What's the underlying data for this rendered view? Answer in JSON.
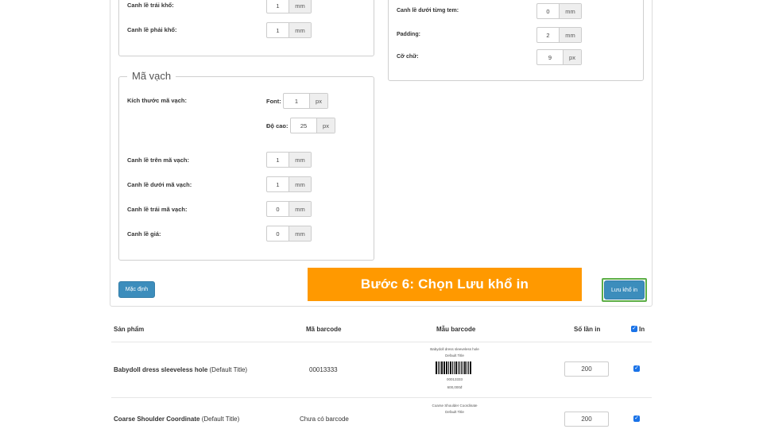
{
  "page_setup": {
    "left_margin": {
      "label": "Canh lề trái khổ:",
      "value": "1",
      "unit": "mm"
    },
    "right_margin": {
      "label": "Canh lề phải khổ:",
      "value": "1",
      "unit": "mm"
    }
  },
  "label_setup": {
    "bottom_margin": {
      "label": "Canh lề dưới từng tem:",
      "value": "0",
      "unit": "mm"
    },
    "padding": {
      "label": "Padding:",
      "value": "2",
      "unit": "mm"
    },
    "font_size": {
      "label": "Cỡ chữ:",
      "value": "9",
      "unit": "px"
    }
  },
  "barcode_section": {
    "legend": "Mã vạch",
    "size_label": "Kích thước mã vạch:",
    "font": {
      "label": "Font:",
      "value": "1",
      "unit": "px"
    },
    "height": {
      "label": "Độ cao:",
      "value": "25",
      "unit": "px"
    },
    "top_margin": {
      "label": "Canh lề trên mã vạch:",
      "value": "1",
      "unit": "mm"
    },
    "bottom_margin": {
      "label": "Canh lề dưới mã vạch:",
      "value": "1",
      "unit": "mm"
    },
    "left_margin": {
      "label": "Canh lề trái mã vạch:",
      "value": "0",
      "unit": "mm"
    },
    "price_margin": {
      "label": "Canh lề giá:",
      "value": "0",
      "unit": "mm"
    }
  },
  "buttons": {
    "default_label": "Mặc định",
    "save_label": "Lưu khổ in"
  },
  "step_banner": "Bước 6: Chọn Lưu khổ in",
  "table": {
    "headers": {
      "product": "Sản phẩm",
      "barcode": "Mã barcode",
      "sample": "Mẫu barcode",
      "count": "Số lần in",
      "print": "In"
    },
    "rows": [
      {
        "name": "Babydoll dress sleeveless hole",
        "variant": "(Default Title)",
        "barcode": "00013333",
        "sample_name": "Babydoll dress sleeveless hole",
        "sample_variant": "Default Title",
        "sample_code": "00013333",
        "sample_price": "600,000đ",
        "count": "200",
        "checked": true
      },
      {
        "name": "Coarse Shoulder Coordinate",
        "variant": "(Default Title)",
        "barcode": "Chưa có barcode",
        "sample_name": "Coarse Shoulder Coordinate",
        "sample_variant": "Default Title",
        "count": "200",
        "checked": true
      }
    ]
  },
  "colors": {
    "primary_button": "#3c8dbc",
    "banner": "#ff9900",
    "highlight_border": "#5cae47",
    "checkbox": "#1a73e8"
  }
}
